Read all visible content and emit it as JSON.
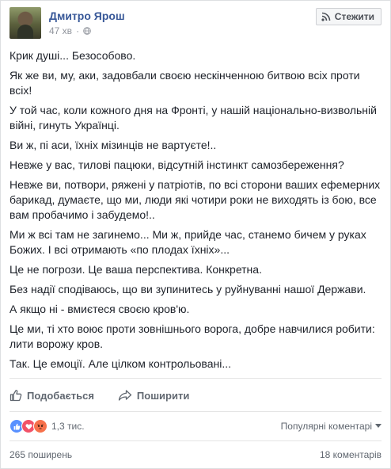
{
  "post": {
    "author": "Дмитро Ярош",
    "time": "47 хв",
    "follow_label": "Стежити",
    "paragraphs": [
      "Крик душі... Безособово.",
      "Як же ви, му,  аки, задовбали своєю нескінченною битвою всіх проти всіх!",
      "У той час, коли кожного дня на Фронті, у нашій національно-визвольній війні, гинуть Українці.",
      "Ви ж, пі  аси, їхніх мізинців не вартуєте!..",
      "Невже у вас, тилові пацюки, відсутній інстинкт самозбереження?",
      "Невже ви, потвори, ряжені у патріотів, по всі сторони ваших ефемерних барикад, думаєте, що ми, люди які чотири роки не виходять із бою, все вам пробачимо і забудемо!..",
      "Ми ж всі там не загинемо... Ми ж, прийде час, станемо бичем у руках Божих. І всі отримають «по плодах їхніх»...",
      "Це не погрози. Це ваша перспектива. Конкретна.",
      "Без надії сподіваюсь, що ви зупинитесь у руйнуванні нашої Держави.",
      "А якщо ні - вмиєтеся своєю кров'ю.",
      "Це ми, ті хто воює проти зовнішнього ворога, добре навчилися робити: лити ворожу кров.",
      "Так. Це емоції. Але цілком контрольовані..."
    ]
  },
  "actions": {
    "like": "Подобається",
    "share": "Поширити"
  },
  "reactions": {
    "count": "1,3 тис.",
    "sort_label": "Популярні коментарі",
    "colors": {
      "like": "#5890ff",
      "love": "#f25268",
      "angry": "#f7714b"
    }
  },
  "footer": {
    "shares": "265 поширень",
    "comments": "18 коментарів"
  }
}
